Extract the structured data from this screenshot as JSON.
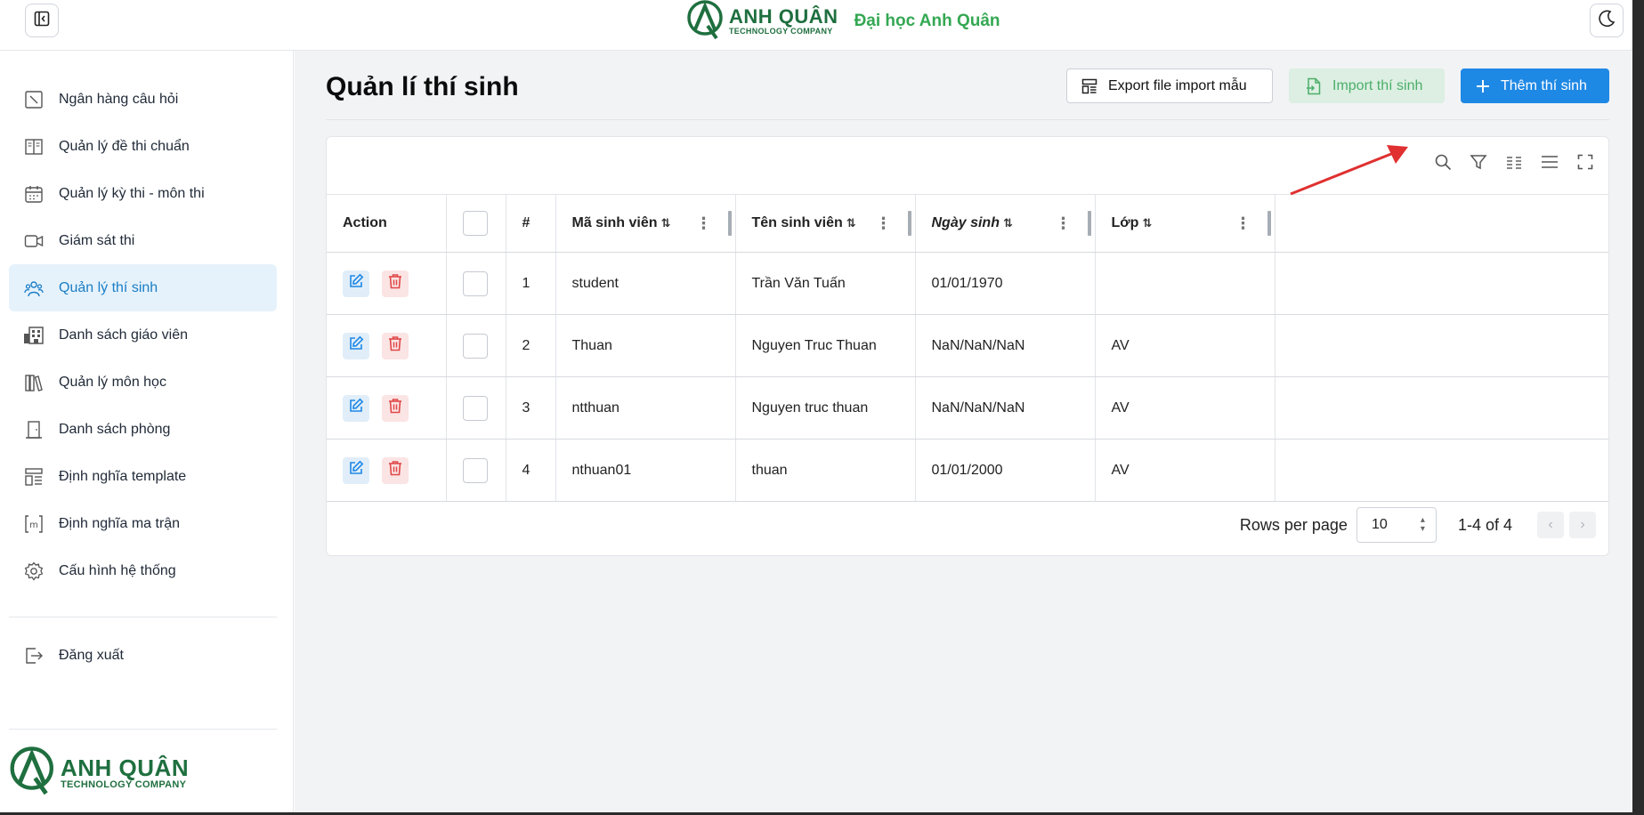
{
  "header": {
    "brand_name": "ANH QUÂN",
    "brand_sub": "TECHNOLOGY COMPANY",
    "university": "Đại học Anh Quân"
  },
  "sidebar": {
    "items": [
      {
        "label": "Ngân hàng câu hỏi",
        "icon": "question-bank-icon"
      },
      {
        "label": "Quản lý đề thi chuẩn",
        "icon": "book-icon"
      },
      {
        "label": "Quản lý kỳ thi - môn thi",
        "icon": "calendar-icon"
      },
      {
        "label": "Giám sát thi",
        "icon": "video-icon"
      },
      {
        "label": "Quản lý thí sinh",
        "icon": "users-icon",
        "active": true
      },
      {
        "label": "Danh sách giáo viên",
        "icon": "building-icon"
      },
      {
        "label": "Quản lý môn học",
        "icon": "books-icon"
      },
      {
        "label": "Danh sách phòng",
        "icon": "door-icon"
      },
      {
        "label": "Định nghĩa template",
        "icon": "template-icon"
      },
      {
        "label": "Định nghĩa ma trận",
        "icon": "matrix-icon"
      },
      {
        "label": "Cấu hình hệ thống",
        "icon": "gear-icon"
      }
    ],
    "logout": "Đăng xuất"
  },
  "page": {
    "title": "Quản lí thí sinh",
    "export_label": "Export file import mẫu",
    "import_label": "Import thí sinh",
    "add_label": "Thêm thí sinh"
  },
  "table": {
    "columns": [
      "Action",
      "",
      "#",
      "Mã sinh viên",
      "Tên sinh viên",
      "Ngày sinh",
      "Lớp"
    ],
    "rows": [
      {
        "no": "1",
        "code": "student",
        "name": "Trần Văn Tuấn",
        "dob": "01/01/1970",
        "class": ""
      },
      {
        "no": "2",
        "code": "Thuan",
        "name": "Nguyen Truc Thuan",
        "dob": "NaN/NaN/NaN",
        "class": "AV"
      },
      {
        "no": "3",
        "code": "ntthuan",
        "name": "Nguyen truc thuan",
        "dob": "NaN/NaN/NaN",
        "class": "AV"
      },
      {
        "no": "4",
        "code": "nthuan01",
        "name": "thuan",
        "dob": "01/01/2000",
        "class": "AV"
      }
    ]
  },
  "pagination": {
    "rows_per_page_label": "Rows per page",
    "rows_per_page": "10",
    "range": "1-4 of 4"
  },
  "colors": {
    "accent": "#1e88e5",
    "active_nav_bg": "#e6f2fb",
    "active_nav_text": "#1a7ec7",
    "brand_green": "#1f6f3f",
    "import_green": "#4cae6a",
    "annotation_red": "#e03030"
  }
}
